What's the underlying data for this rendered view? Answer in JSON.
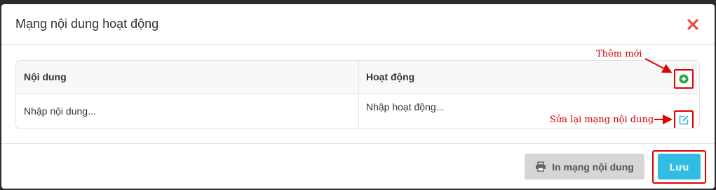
{
  "modal": {
    "title": "Mạng nội dung hoạt động",
    "close_icon": "close-icon",
    "close_color": "#e74c3c"
  },
  "table": {
    "headers": [
      "Nội dung",
      "Hoạt động"
    ],
    "row": {
      "content_placeholder": "Nhập nội dung...",
      "activity_placeholder": "Nhập hoạt động..."
    },
    "add_icon": "plus-circle-icon",
    "add_color": "#28a745",
    "edit_icon": "edit-icon",
    "edit_color": "#30bde1"
  },
  "annotations": {
    "add_label": "Thêm mới",
    "edit_label": "Sửa lại mạng nội dung",
    "color": "#d40000"
  },
  "footer": {
    "print_label": "In mạng nội dung",
    "print_icon": "printer-icon",
    "save_label": "Lưu",
    "save_color": "#30bde1"
  }
}
